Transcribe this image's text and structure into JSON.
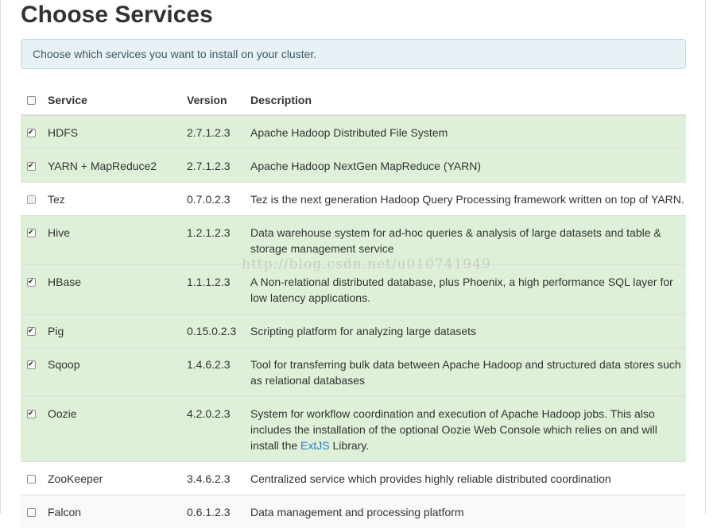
{
  "page": {
    "title": "Choose Services",
    "info": "Choose which services you want to install on your cluster."
  },
  "table": {
    "headers": {
      "service": "Service",
      "version": "Version",
      "description": "Description"
    },
    "rows": [
      {
        "name": "HDFS",
        "version": "2.7.1.2.3",
        "description": "Apache Hadoop Distributed File System",
        "checked": true,
        "style": "selected"
      },
      {
        "name": "YARN + MapReduce2",
        "version": "2.7.1.2.3",
        "description": "Apache Hadoop NextGen MapReduce (YARN)",
        "checked": true,
        "style": "selected"
      },
      {
        "name": "Tez",
        "version": "0.7.0.2.3",
        "description": "Tez is the next generation Hadoop Query Processing framework written on top of YARN.",
        "checked": false,
        "disabled": true,
        "style": "unselected"
      },
      {
        "name": "Hive",
        "version": "1.2.1.2.3",
        "description": "Data warehouse system for ad-hoc queries & analysis of large datasets and table & storage management service",
        "checked": true,
        "style": "selected"
      },
      {
        "name": "HBase",
        "version": "1.1.1.2.3",
        "description": "A Non-relational distributed database, plus Phoenix, a high performance SQL layer for low latency applications.",
        "checked": true,
        "style": "selected"
      },
      {
        "name": "Pig",
        "version": "0.15.0.2.3",
        "description": "Scripting platform for analyzing large datasets",
        "checked": true,
        "style": "selected"
      },
      {
        "name": "Sqoop",
        "version": "1.4.6.2.3",
        "description": "Tool for transferring bulk data between Apache Hadoop and structured data stores such as relational databases",
        "checked": true,
        "style": "selected"
      },
      {
        "name": "Oozie",
        "version": "4.2.0.2.3",
        "description_before": "System for workflow coordination and execution of Apache Hadoop jobs. This also includes the installation of the optional Oozie Web Console which relies on and will install the ",
        "description_link": "ExtJS",
        "description_after": " Library.",
        "checked": true,
        "style": "selected"
      },
      {
        "name": "ZooKeeper",
        "version": "3.4.6.2.3",
        "description": "Centralized service which provides highly reliable distributed coordination",
        "checked": false,
        "style": "unselected"
      },
      {
        "name": "Falcon",
        "version": "0.6.1.2.3",
        "description": "Data management and processing platform",
        "checked": false,
        "style": "alt"
      }
    ]
  },
  "watermark": "http://blog.csdn.net/u010741949",
  "colors": {
    "selected_row": "#dff0d8",
    "info_background": "#e8f1f5",
    "link": "#2a7ac8"
  }
}
